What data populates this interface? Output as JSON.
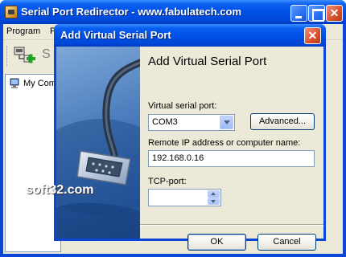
{
  "main_window": {
    "title": "Serial Port Redirector - www.fabulatech.com",
    "menu": [
      "Program",
      "P"
    ],
    "toolbar_second_label": "S",
    "tree_root_label": "My Com"
  },
  "dialog": {
    "title": "Add Virtual Serial Port",
    "heading": "Add Virtual Serial Port",
    "virtual_port_label": "Virtual serial port:",
    "virtual_port_value": "COM3",
    "advanced_button": "Advanced...",
    "remote_label": "Remote IP address or computer name:",
    "remote_value": "192.168.0.16",
    "tcp_label": "TCP-port:",
    "tcp_value": "",
    "ok_button": "OK",
    "cancel_button": "Cancel",
    "close_button": "✕"
  },
  "watermark": "soft32.com",
  "icons": {
    "app": "serial-port-app-icon",
    "toolbar_add": "add-port-icon",
    "tree_root": "computer-icon"
  },
  "colors": {
    "titlebar": "#0050e6",
    "client": "#ece9d8",
    "banner": "#4e7fbe"
  }
}
